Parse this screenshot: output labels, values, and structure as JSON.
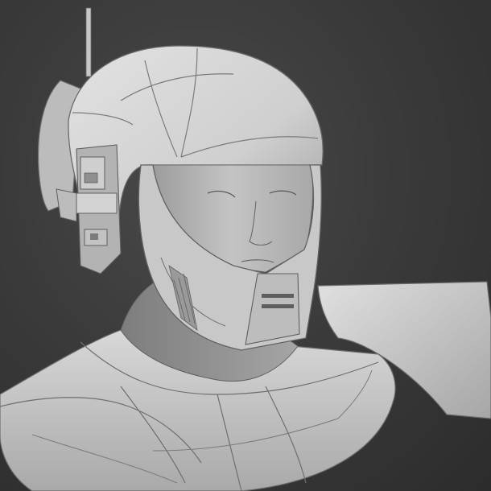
{
  "viewport": {
    "background_color": "#3a3a3a",
    "model_color": "#c9c9c9",
    "shadow_color": "#8d8d8d",
    "line_color": "#5a5a5a"
  }
}
